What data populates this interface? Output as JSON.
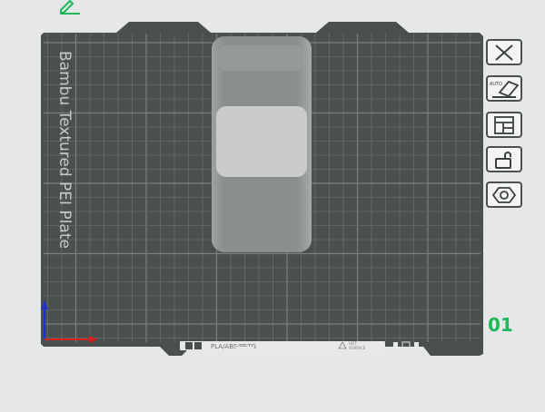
{
  "plate": {
    "name": "Bambu Textured PEI Plate",
    "filament_label": "PLA/ABS/PETG",
    "surface_label_line1": "HOT",
    "surface_label_line2": "SURFACE",
    "number": "01"
  },
  "toolbar": {
    "buttons": [
      {
        "id": "close",
        "icon": "close-icon"
      },
      {
        "id": "auto-orient",
        "icon": "auto-orient-icon",
        "label": "AUTO"
      },
      {
        "id": "arrange",
        "icon": "arrange-icon"
      },
      {
        "id": "lock",
        "icon": "unlock-icon"
      },
      {
        "id": "settings",
        "icon": "hex-nut-icon"
      }
    ]
  },
  "colors": {
    "background": "#e6e7e8",
    "bed": "#4a4f50",
    "grid": "#676c6d",
    "model_body": "#8c9090",
    "model_highlight": "#c9cbcb",
    "plate_number": "#1db858",
    "edit_icon": "#1db858",
    "axis_x": "#d42121",
    "axis_y": "#2130c8"
  }
}
